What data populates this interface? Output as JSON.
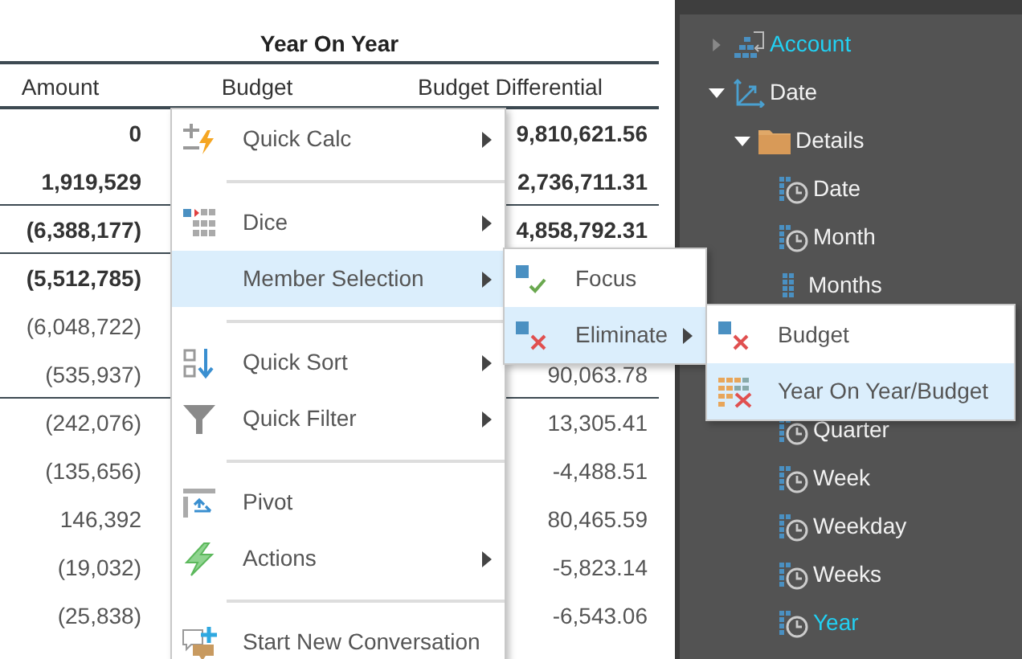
{
  "table": {
    "title": "Year On Year",
    "columns": [
      "Amount",
      "Budget",
      "Budget Differential"
    ],
    "rows": [
      {
        "amount": "0",
        "differential": "9,810,621.56",
        "bold": true,
        "rule_below": false
      },
      {
        "amount": "1,919,529",
        "differential": "2,736,711.31",
        "bold": true,
        "rule_below": true
      },
      {
        "amount": "(6,388,177)",
        "differential": "4,858,792.31",
        "bold": true,
        "rule_below": true
      },
      {
        "amount": "(5,512,785)",
        "bold": true,
        "rule_below": false
      },
      {
        "amount": "(6,048,722)",
        "bold": false,
        "rule_below": false
      },
      {
        "amount": "(535,937)",
        "differential": "90,063.78",
        "bold": false,
        "rule_below": true
      },
      {
        "amount": "(242,076)",
        "differential": "13,305.41",
        "bold": false,
        "rule_below": false
      },
      {
        "amount": "(135,656)",
        "differential": "-4,488.51",
        "bold": false,
        "rule_below": false
      },
      {
        "amount": "146,392",
        "differential": "80,465.59",
        "bold": false,
        "rule_below": false
      },
      {
        "amount": "(19,032)",
        "differential": "-5,823.14",
        "bold": false,
        "rule_below": false
      },
      {
        "amount": "(25,838)",
        "differential": "-6,543.06",
        "bold": false,
        "rule_below": false
      }
    ]
  },
  "context_menu": {
    "items": [
      {
        "kind": "item",
        "label": "Quick Calc",
        "has_submenu": true,
        "selected": false
      },
      {
        "kind": "separator"
      },
      {
        "kind": "item",
        "label": "Dice",
        "has_submenu": true,
        "selected": false
      },
      {
        "kind": "item",
        "label": "Member Selection",
        "has_submenu": true,
        "selected": true,
        "expanded": true,
        "submenu": {
          "items": [
            {
              "kind": "item",
              "label": "Focus",
              "has_submenu": false,
              "selected": false
            },
            {
              "kind": "item",
              "label": "Eliminate",
              "has_submenu": true,
              "selected": true,
              "expanded": true,
              "submenu": {
                "items": [
                  {
                    "kind": "item",
                    "label": "Budget",
                    "has_submenu": false,
                    "selected": false
                  },
                  {
                    "kind": "item",
                    "label": "Year On Year/Budget",
                    "has_submenu": false,
                    "selected": true
                  }
                ]
              }
            }
          ]
        }
      },
      {
        "kind": "separator"
      },
      {
        "kind": "item",
        "label": "Quick Sort",
        "has_submenu": true,
        "selected": false
      },
      {
        "kind": "item",
        "label": "Quick Filter",
        "has_submenu": true,
        "selected": false
      },
      {
        "kind": "separator"
      },
      {
        "kind": "item",
        "label": "Pivot",
        "has_submenu": false,
        "selected": false
      },
      {
        "kind": "item",
        "label": "Actions",
        "has_submenu": true,
        "selected": false
      },
      {
        "kind": "separator"
      },
      {
        "kind": "item",
        "label": "Start New Conversation",
        "has_submenu": false,
        "selected": false
      }
    ]
  },
  "tree": {
    "items": [
      {
        "kind": "hierarchy",
        "label": "Account",
        "expanded": false,
        "active": true
      },
      {
        "kind": "dimension",
        "label": "Date",
        "expanded": true,
        "active": false,
        "children": [
          {
            "kind": "folder",
            "label": "Details",
            "expanded": true,
            "active": false,
            "children": [
              {
                "kind": "time",
                "label": "Date",
                "active": false
              },
              {
                "kind": "time",
                "label": "Month",
                "active": false
              },
              {
                "kind": "level",
                "label": "Months",
                "active": false
              },
              {
                "kind": "covered"
              },
              {
                "kind": "covered"
              },
              {
                "kind": "time",
                "label": "Quarter",
                "active": false
              },
              {
                "kind": "time",
                "label": "Week",
                "active": false
              },
              {
                "kind": "time",
                "label": "Weekday",
                "active": false
              },
              {
                "kind": "time",
                "label": "Weeks",
                "active": false
              },
              {
                "kind": "time",
                "label": "Year",
                "active": true
              }
            ]
          }
        ]
      }
    ]
  }
}
